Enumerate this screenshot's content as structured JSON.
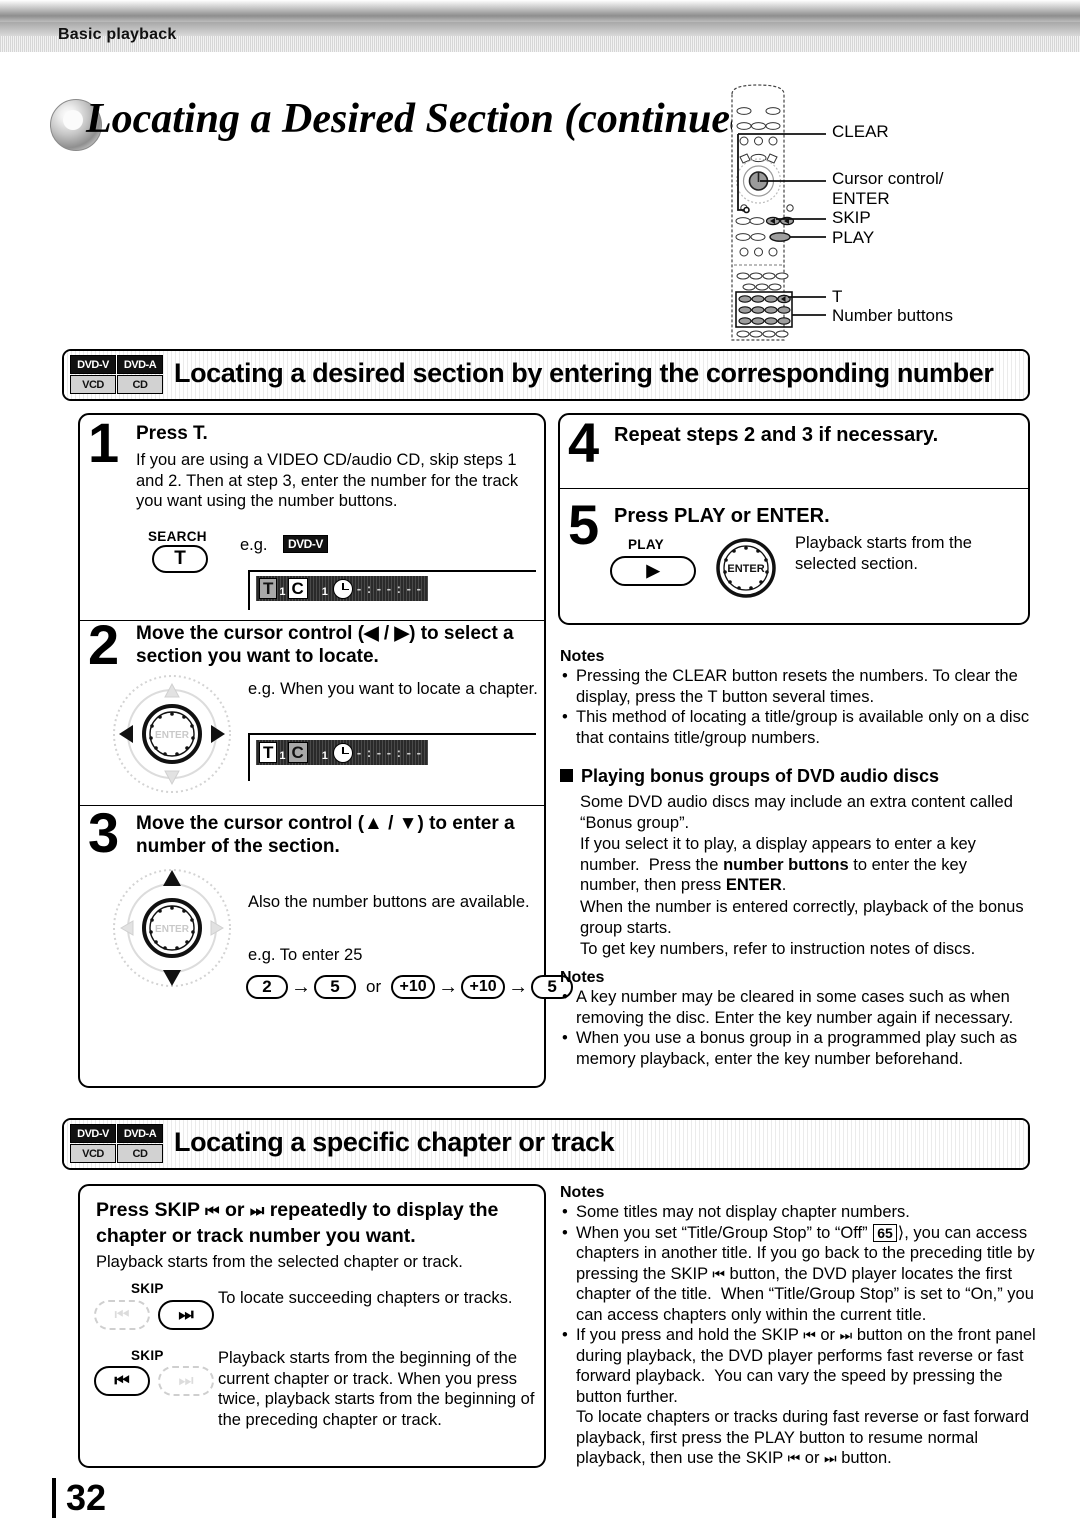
{
  "header": {
    "running_title": "Basic playback"
  },
  "page": {
    "number": "32",
    "title": "Locating a Desired Section (continued)"
  },
  "remote": {
    "callouts": [
      {
        "label": "CLEAR"
      },
      {
        "label": "Cursor control/"
      },
      {
        "label": "ENTER"
      },
      {
        "label": "SKIP"
      },
      {
        "label": "PLAY"
      },
      {
        "label": "T"
      },
      {
        "label": "Number buttons"
      }
    ]
  },
  "section1": {
    "title": "Locating a desired section by entering the corresponding number",
    "discs": [
      {
        "label": "DVD-V",
        "active": true
      },
      {
        "label": "DVD-A",
        "active": true
      },
      {
        "label": "VCD",
        "active": false
      },
      {
        "label": "CD",
        "active": false
      }
    ],
    "steps": [
      {
        "number": "1",
        "heading": "Press T.",
        "body": "If you are using a VIDEO CD/audio CD, skip steps 1 and 2. Then at step 3, enter the number for the track you want using the number buttons.",
        "button_label": "SEARCH",
        "button_glyph": "T",
        "example_prefix": "e.g.",
        "example_badge": "DVD-V",
        "lcd": {
          "t": "T",
          "t_sub": "1",
          "c": "C",
          "c_sub": "1",
          "dashes": "- : - - : - -",
          "highlight": "T"
        }
      },
      {
        "number": "2",
        "heading": "Move the cursor control (◀ / ▶) to select a section you want to locate.",
        "body": "e.g. When you want to locate a chapter.",
        "lcd": {
          "t": "T",
          "t_sub": "1",
          "c": "C",
          "c_sub": "1",
          "dashes": "- : - - : - -",
          "highlight": "C"
        }
      },
      {
        "number": "3",
        "heading": "Move the cursor control (▲ / ▼) to enter a number of the section.",
        "body": "Also the number buttons are available.",
        "example": "e.g. To enter 25",
        "keys_first": [
          "2",
          "5"
        ],
        "or_label": "or",
        "keys_second": [
          "+10",
          "+10",
          "5"
        ]
      },
      {
        "number": "4",
        "heading": "Repeat steps 2 and 3 if necessary."
      },
      {
        "number": "5",
        "heading": "Press PLAY or ENTER.",
        "play_label": "PLAY",
        "enter_label": "ENTER",
        "body": "Playback starts from the selected section."
      }
    ],
    "notes_label": "Notes",
    "notes": [
      "Pressing the CLEAR button resets the numbers. To clear the display, press the T button several times.",
      "This method of locating a title/group is available only on a disc that contains title/group numbers."
    ],
    "bonus": {
      "heading": "Playing bonus groups of DVD audio discs",
      "paragraphs": [
        "Some DVD audio discs may include an extra content called “Bonus group”.",
        "If you select it to play, a display appears to enter a key number.  Press the number buttons to enter the key number, then press ENTER.",
        "When the number is entered correctly, playback of the bonus group starts.",
        "To get key numbers, refer to instruction notes of discs."
      ],
      "notes_label": "Notes",
      "notes": [
        "A key number may be cleared in some cases such as when removing the disc. Enter the key number again if necessary.",
        "When you use a bonus group in a programmed play such as memory playback, enter the key number beforehand."
      ]
    }
  },
  "section2": {
    "title": "Locating a specific chapter or track",
    "discs": [
      {
        "label": "DVD-V",
        "active": true
      },
      {
        "label": "DVD-A",
        "active": true
      },
      {
        "label": "VCD",
        "active": false
      },
      {
        "label": "CD",
        "active": false
      }
    ],
    "heading": "Press SKIP ᐅ◀◀ or ▶▶ᐁ repeatedly to display the chapter or track number you want.",
    "subtext": "Playback starts from the selected chapter or track.",
    "rows": [
      {
        "skip_label": "SKIP",
        "text": "To locate succeeding chapters or tracks.",
        "active_button": "forward"
      },
      {
        "skip_label": "SKIP",
        "text": "Playback starts from the beginning of the current chapter or track. When you press twice, playback starts from the beginning of the preceding chapter or track.",
        "active_button": "back"
      }
    ],
    "notes_label": "Notes",
    "notes": [
      "Some titles may not display chapter numbers.",
      "When you set “Title/Group Stop” to “Off” 65 , you can access chapters in another title. If you go back to the preceding title by pressing the SKIP ᐅ◀◀ button, the DVD player locates the first chapter of the title.  When “Title/Group Stop” is set to “On,” you can access chapters only within the current title.",
      "If you press and hold the SKIP ᐅ◀◀ or ▶▶ᐁ button on the front panel during playback, the DVD player performs fast reverse or fast forward playback.  You can vary the speed by pressing the button further. To locate chapters or tracks during fast reverse or fast forward playback, first press the PLAY button to resume normal playback, then use the SKIP ᐅ◀◀ or ▶▶ᐁ button."
    ],
    "page_ref": "65"
  }
}
